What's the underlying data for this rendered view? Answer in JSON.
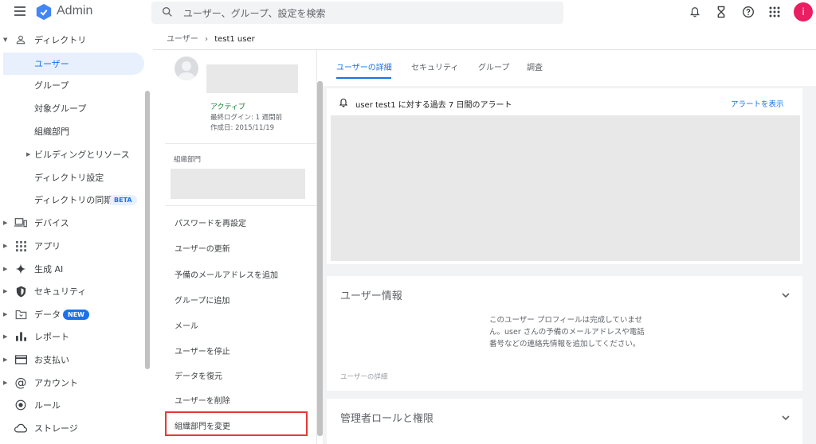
{
  "app": {
    "title": "Admin",
    "avatar_initial": "i"
  },
  "search": {
    "placeholder": "ユーザー、グループ、設定を検索"
  },
  "top_icons": [
    "bell-icon",
    "hourglass-icon",
    "help-icon",
    "apps-grid-icon"
  ],
  "nav": {
    "directory": "ディレクトリ",
    "users": "ユーザー",
    "groups": "グループ",
    "target_groups": "対象グループ",
    "org_units": "組織部門",
    "buildings": "ビルディングとリソース",
    "dir_settings": "ディレクトリ設定",
    "dir_sync": "ディレクトリの同期",
    "beta_badge": "BETA",
    "devices": "デバイス",
    "apps": "アプリ",
    "gen_ai": "生成 AI",
    "security": "セキュリティ",
    "data": "データ",
    "new_badge": "NEW",
    "reports": "レポート",
    "billing": "お支払い",
    "account": "アカウント",
    "rules": "ルール",
    "storage": "ストレージ"
  },
  "breadcrumb": {
    "parent": "ユーザー",
    "sep": "›",
    "current": "test1 user"
  },
  "user": {
    "status": "アクティブ",
    "last_login": "最終ログイン: 1 週間前",
    "created": "作成日: 2015/11/19",
    "org_label": "組織部門"
  },
  "actions": {
    "reset_password": "パスワードを再設定",
    "update_user": "ユーザーの更新",
    "add_alt_email": "予備のメールアドレスを追加",
    "add_to_group": "グループに追加",
    "mail": "メール",
    "suspend": "ユーザーを停止",
    "restore_data": "データを復元",
    "delete_user": "ユーザーを削除",
    "change_org": "組織部門を変更"
  },
  "tabs": {
    "details": "ユーザーの詳細",
    "security": "セキュリティ",
    "groups": "グループ",
    "investigate": "調査"
  },
  "alerts": {
    "text": "user test1 に対する過去 7 日間のアラート",
    "link": "アラートを表示"
  },
  "user_info": {
    "title": "ユーザー情報",
    "message": "このユーザー プロフィールは完成していません。user さんの予備のメールアドレスや電話番号などの連絡先情報を追加してください。",
    "footer": "ユーザーの詳細"
  },
  "admin_roles": {
    "title": "管理者ロールと権限"
  },
  "colors": {
    "accent": "#1a73e8",
    "active_green": "#188038",
    "highlight": "#e53935",
    "avatar": "#e91e63"
  }
}
